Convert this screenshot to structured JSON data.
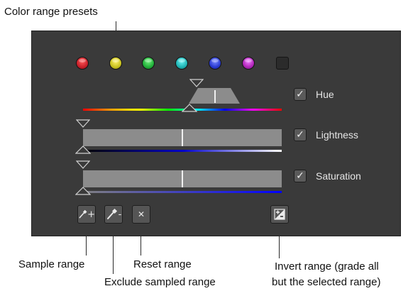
{
  "callouts": {
    "presets": "Color range presets",
    "sample": "Sample range",
    "exclude": "Exclude sampled range",
    "reset": "Reset range",
    "invert_line1": "Invert range (grade all",
    "invert_line2": "but the selected range)"
  },
  "presets": [
    {
      "name": "red",
      "color": "#c8202a"
    },
    {
      "name": "yellow",
      "color": "#c8c220"
    },
    {
      "name": "green",
      "color": "#22b03a"
    },
    {
      "name": "cyan",
      "color": "#20b4b4"
    },
    {
      "name": "blue",
      "color": "#2a3ad0"
    },
    {
      "name": "magenta",
      "color": "#b026b8"
    },
    {
      "name": "none",
      "color": "#2b2b2b"
    }
  ],
  "sliders": {
    "hue": {
      "label": "Hue",
      "checked": true,
      "checkmark": "✓"
    },
    "lightness": {
      "label": "Lightness",
      "checked": true,
      "checkmark": "✓"
    },
    "saturation": {
      "label": "Saturation",
      "checked": true,
      "checkmark": "✓"
    }
  },
  "buttons": {
    "sample_icon": "pipette-plus-icon",
    "sample_glyph": "+",
    "exclude_icon": "pipette-minus-icon",
    "exclude_glyph": "-",
    "reset_icon": "close-icon",
    "reset_glyph": "✕",
    "invert_icon": "invert-range-icon"
  }
}
